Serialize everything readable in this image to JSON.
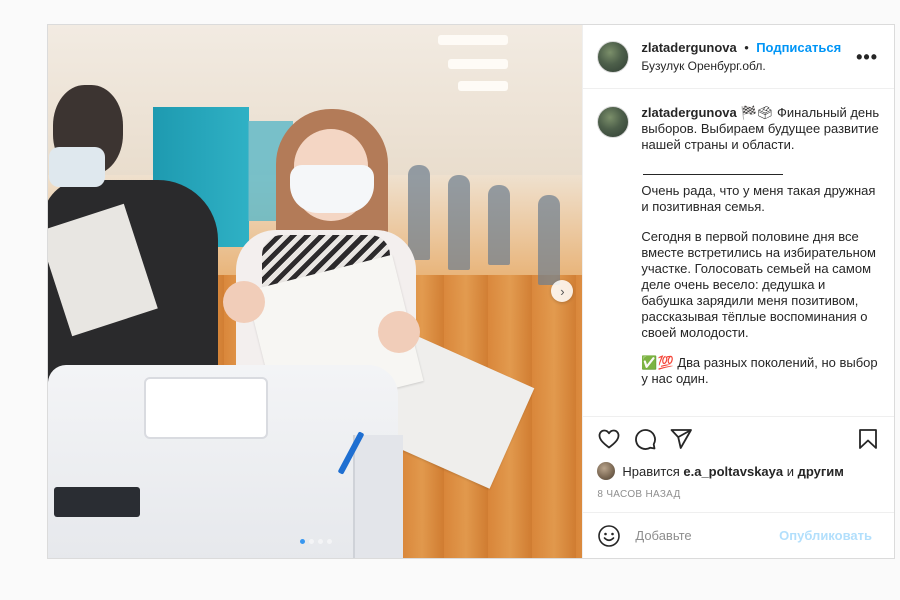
{
  "post": {
    "username": "zlatadergunova",
    "bullet": "•",
    "follow_label": "Подписаться",
    "location": "Бузулук Оренбург.обл.",
    "more_label": "•••",
    "next_label": "›",
    "caption": {
      "username": "zlatadergunova",
      "p1": "🏁🗳 Финальный день выборов. Выбираем будущее развитие нашей страны и области.",
      "p2": "Очень рада, что у меня такая дружная и позитивная семья.",
      "p3": "Сегодня в первой половине дня все вместе встретились на избирательном участке. Голосовать семьей на самом деле очень весело: дедушка и бабушка зарядили меня позитивом, рассказывая тёплые воспоминания о своей молодости.",
      "p4": "✅💯 Два разных поколений, но выбор у нас один."
    },
    "likes": {
      "prefix": "Нравится",
      "user": "e.a_poltavskaya",
      "conj": "и",
      "others": "другим"
    },
    "time": "8 ЧАСОВ НАЗАД",
    "comment": {
      "placeholder": "Добавьте",
      "value": "",
      "publish_label": "Опубликовать"
    }
  },
  "colors": {
    "accent": "#0095f6",
    "publish_disabled": "#b2dffc",
    "border": "#dbdbdb",
    "muted": "#8e8e8e",
    "carousel_active_dot": "#3897f0"
  },
  "icons": [
    "heart-icon",
    "comment-icon",
    "share-icon",
    "bookmark-icon",
    "emoji-icon",
    "chevron-right-icon",
    "more-icon"
  ],
  "carousel": {
    "slides": 4,
    "active": 1
  }
}
